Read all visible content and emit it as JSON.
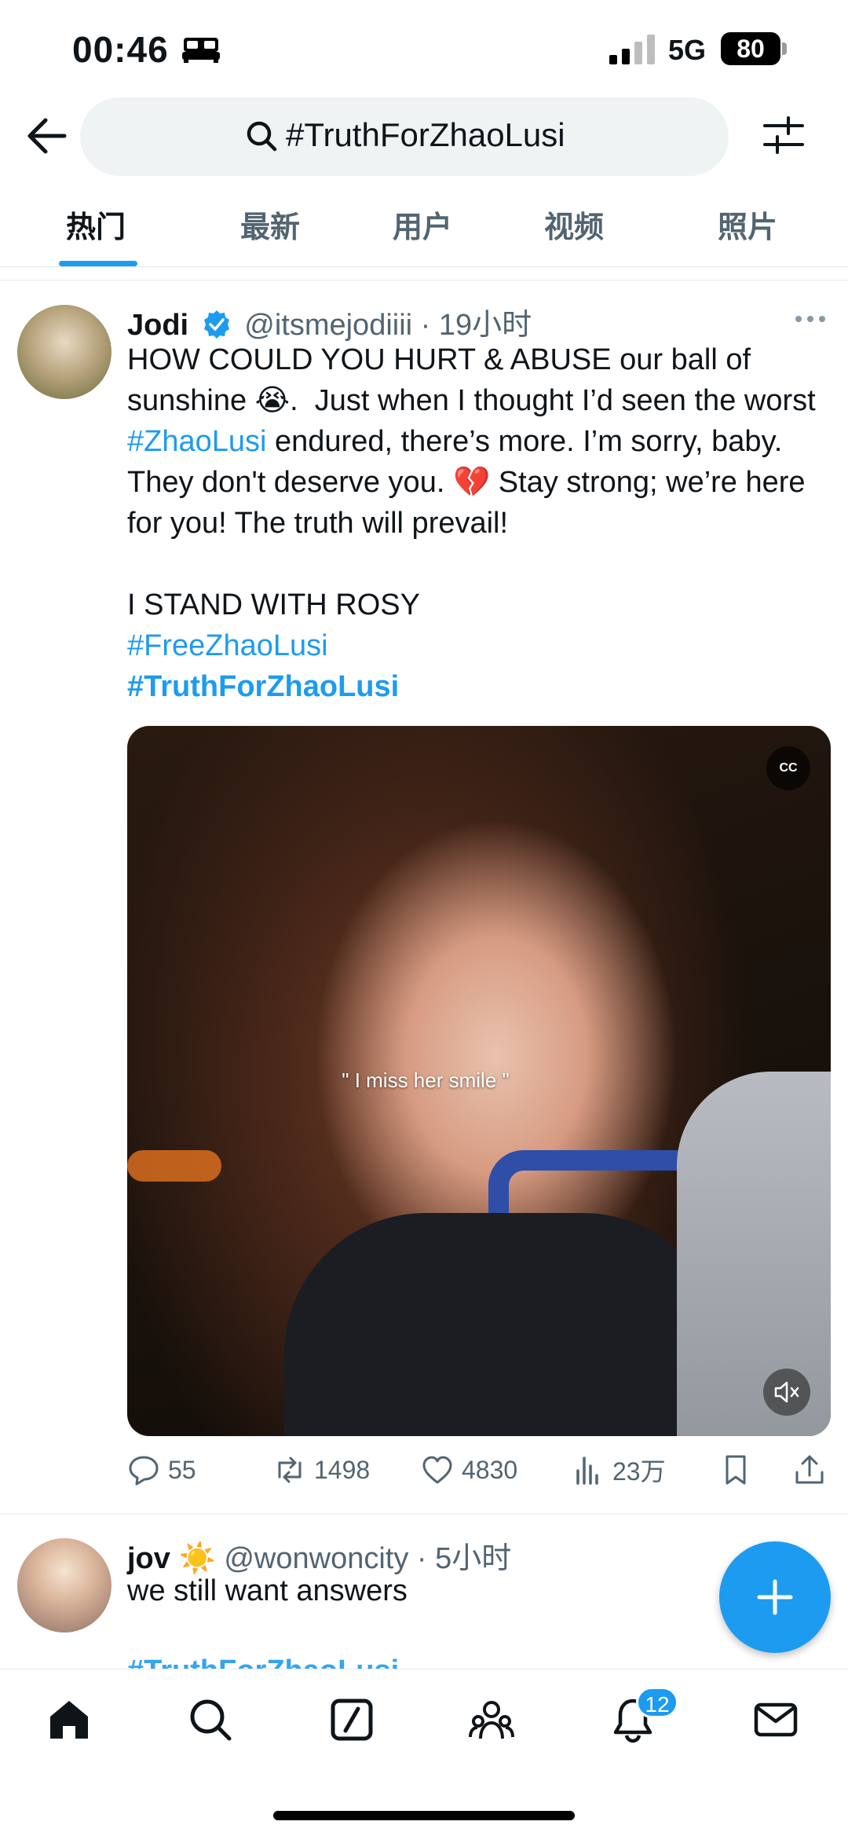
{
  "status_bar": {
    "time": "00:46",
    "network": "5G",
    "battery": "80"
  },
  "search": {
    "query": "#TruthForZhaoLusi"
  },
  "tabs": [
    {
      "label": "热门",
      "active": true
    },
    {
      "label": "最新",
      "active": false
    },
    {
      "label": "用户",
      "active": false
    },
    {
      "label": "视频",
      "active": false
    },
    {
      "label": "照片",
      "active": false
    }
  ],
  "tweet1": {
    "name": "Jodi",
    "handle": "@itsmejodiiii",
    "time": "· 19小时",
    "text_1": "HOW COULD YOU HURT & ABUSE our ball of sunshine 😭.  Just when I thought I’d seen the worst ",
    "hashtag_inline": "#ZhaoLusi",
    "text_2": " endured, there’s more. I’m sorry, baby. They don't deserve you. 💔 Stay strong; we’re here for you! The truth will prevail!",
    "text_3": "I STAND WITH ROSY",
    "hashtag_1": "#FreeZhaoLusi",
    "hashtag_2": "#TruthForZhaoLusi",
    "media_caption": "\" I miss her smile \"",
    "cc_label": "CC",
    "replies": "55",
    "retweets": "1498",
    "likes": "4830",
    "views": "23万"
  },
  "tweet2": {
    "name": "jov",
    "emoji": "☀️",
    "handle": "@wonwoncity",
    "time": "· 5小时",
    "text": "we still want answers",
    "hashtag": "#TruthForZhaoLusi"
  },
  "bottom_nav": {
    "notifications_count": "12",
    "items": [
      "home-icon",
      "search-icon",
      "grok-icon",
      "communities-icon",
      "notifications-icon",
      "messages-icon"
    ]
  },
  "colors": {
    "accent": "#1d9bf0",
    "text": "#0f1419",
    "muted": "#536471"
  }
}
